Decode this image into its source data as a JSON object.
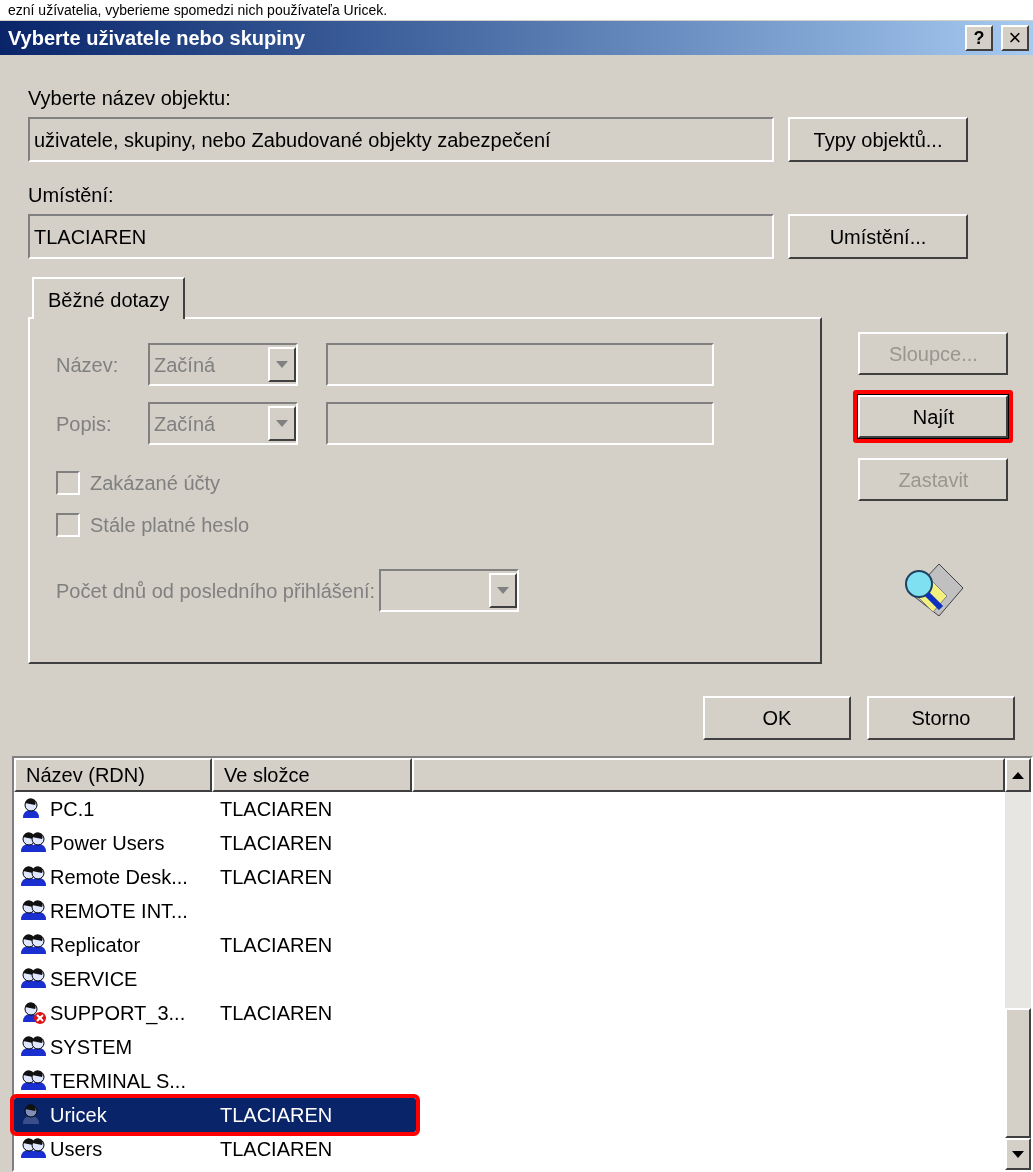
{
  "caption": "ezní užívatelia, vyberieme spomedzi nich používateľa Uricek.",
  "window": {
    "title": "Vyberte uživatele nebo skupiny",
    "help": "?",
    "close": "×"
  },
  "object_type": {
    "label": "Vyberte název objektu:",
    "value": "uživatele, skupiny, nebo Zabudované objekty zabezpečení",
    "button": "Typy objektů..."
  },
  "location": {
    "label": "Umístění:",
    "value": "TLACIAREN",
    "button": "Umístění..."
  },
  "tabs": [
    {
      "label": "Běžné dotazy",
      "selected": true
    }
  ],
  "query": {
    "disabled": true,
    "rows": [
      {
        "label": "Název:",
        "mode": "Začíná"
      },
      {
        "label": "Popis:",
        "mode": "Začíná"
      }
    ],
    "checkboxes": [
      {
        "label": "Zakázané účty",
        "checked": false
      },
      {
        "label": "Stále platné heslo",
        "checked": false
      }
    ],
    "days_label": "Počet dnů od posledního přihlášení:"
  },
  "side_buttons": [
    {
      "label": "Sloupce...",
      "disabled": true,
      "highlighted": false
    },
    {
      "label": "Najít",
      "disabled": false,
      "highlighted": true
    },
    {
      "label": "Zastavit",
      "disabled": true,
      "highlighted": false
    }
  ],
  "buttons": [
    "OK",
    "Storno"
  ],
  "results": {
    "columns": [
      "Název (RDN)",
      "Ve složce"
    ],
    "rows": [
      {
        "name": "PC.1",
        "folder": "TLACIAREN",
        "kind": "user",
        "disabled": false,
        "selected": false,
        "highlighted": false
      },
      {
        "name": "Power Users",
        "folder": "TLACIAREN",
        "kind": "group",
        "disabled": false,
        "selected": false,
        "highlighted": false
      },
      {
        "name": "Remote Desk...",
        "folder": "TLACIAREN",
        "kind": "group",
        "disabled": false,
        "selected": false,
        "highlighted": false
      },
      {
        "name": "REMOTE INT...",
        "kind": "group",
        "disabled": false,
        "selected": false,
        "highlighted": false
      },
      {
        "name": "Replicator",
        "folder": "TLACIAREN",
        "kind": "group",
        "disabled": false,
        "selected": false,
        "highlighted": false
      },
      {
        "name": "SERVICE",
        "kind": "group",
        "disabled": false,
        "selected": false,
        "highlighted": false
      },
      {
        "name": "SUPPORT_3...",
        "folder": "TLACIAREN",
        "kind": "user",
        "disabled": true,
        "selected": false,
        "highlighted": false
      },
      {
        "name": "SYSTEM",
        "kind": "group",
        "disabled": false,
        "selected": false,
        "highlighted": false
      },
      {
        "name": "TERMINAL S...",
        "kind": "group",
        "disabled": false,
        "selected": false,
        "highlighted": false
      },
      {
        "name": "Uricek",
        "folder": "TLACIAREN",
        "kind": "user",
        "disabled": false,
        "selected": true,
        "highlighted": true
      },
      {
        "name": "Users",
        "folder": "TLACIAREN",
        "kind": "group",
        "disabled": false,
        "selected": false,
        "highlighted": false
      }
    ]
  }
}
